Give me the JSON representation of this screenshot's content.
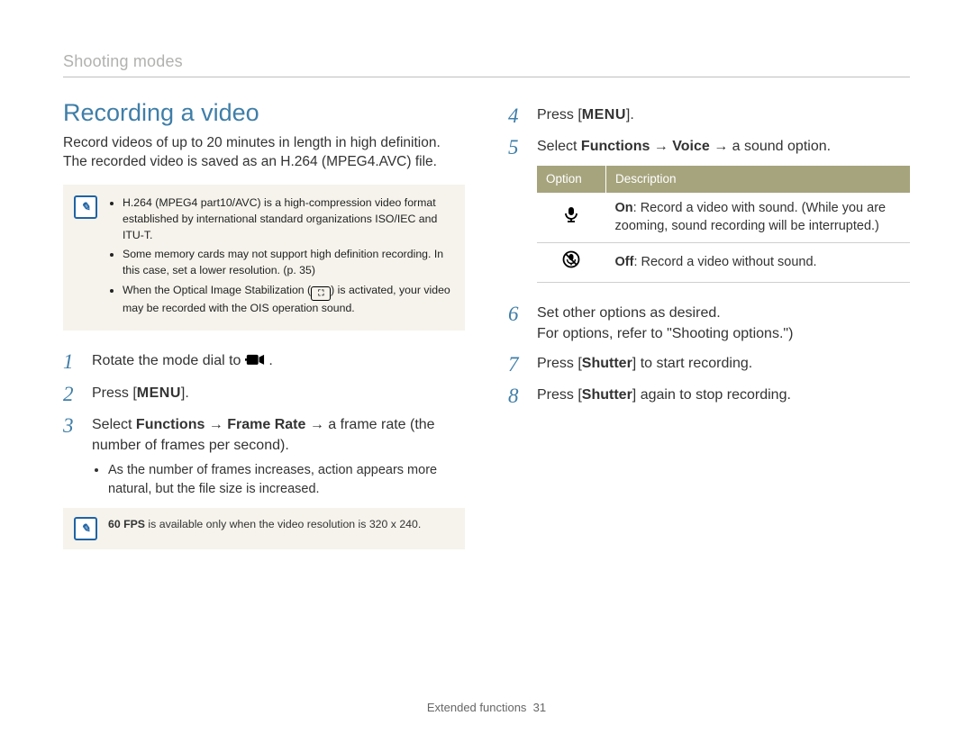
{
  "chapter": "Shooting modes",
  "section_title": "Recording a video",
  "intro_line1": "Record videos of up to 20 minutes in length in high definition.",
  "intro_line2": "The recorded video is saved as an H.264 (MPEG4.AVC) file.",
  "info_bullets": [
    "H.264 (MPEG4 part10/AVC) is a high-compression video format established by international standard organizations ISO/IEC and ITU-T.",
    "Some memory cards may not support high definition recording. In this case, set a lower resolution. (p. 35)",
    "When the Optical Image Stabilization (         ) is activated, your video may be recorded with the OIS operation sound."
  ],
  "ois_icon_label": "OIS-icon",
  "note_60fps_bold": "60 FPS",
  "note_60fps_rest": " is available only when the video resolution is 320 x 240.",
  "steps_left": {
    "s1": "Rotate the mode dial to ",
    "s1_end": ".",
    "s2_pre": "Press [",
    "s2_menu": "MENU",
    "s2_post": "].",
    "s3_a": "Select ",
    "s3_func": "Functions",
    "s3_arrow1": " → ",
    "s3_fr": "Frame Rate",
    "s3_arrow2": " → ",
    "s3_rest": "a frame rate (the number of frames per second).",
    "s3_bullet": "As the number of frames increases, action appears more natural, but the file size is increased."
  },
  "steps_right": {
    "s4_pre": "Press [",
    "s4_menu": "MENU",
    "s4_post": "].",
    "s5_a": "Select ",
    "s5_func": "Functions",
    "s5_arrow1": " → ",
    "s5_voice": "Voice",
    "s5_arrow2": " → ",
    "s5_rest": "a sound option.",
    "s6_a": "Set other options as desired.",
    "s6_b": "For options, refer to \"Shooting options.\")",
    "s7_a": "Press [",
    "s7_b": "Shutter",
    "s7_c": "] to start recording.",
    "s8_a": "Press [",
    "s8_b": "Shutter",
    "s8_c": "] again to stop recording."
  },
  "option_table": {
    "head_option": "Option",
    "head_desc": "Description",
    "on_b": "On",
    "on_rest": ": Record a video with sound. (While you are zooming, sound recording will be interrupted.)",
    "off_b": "Off",
    "off_rest": ": Record a video without sound."
  },
  "footer_label": "Extended functions",
  "footer_page": "31"
}
